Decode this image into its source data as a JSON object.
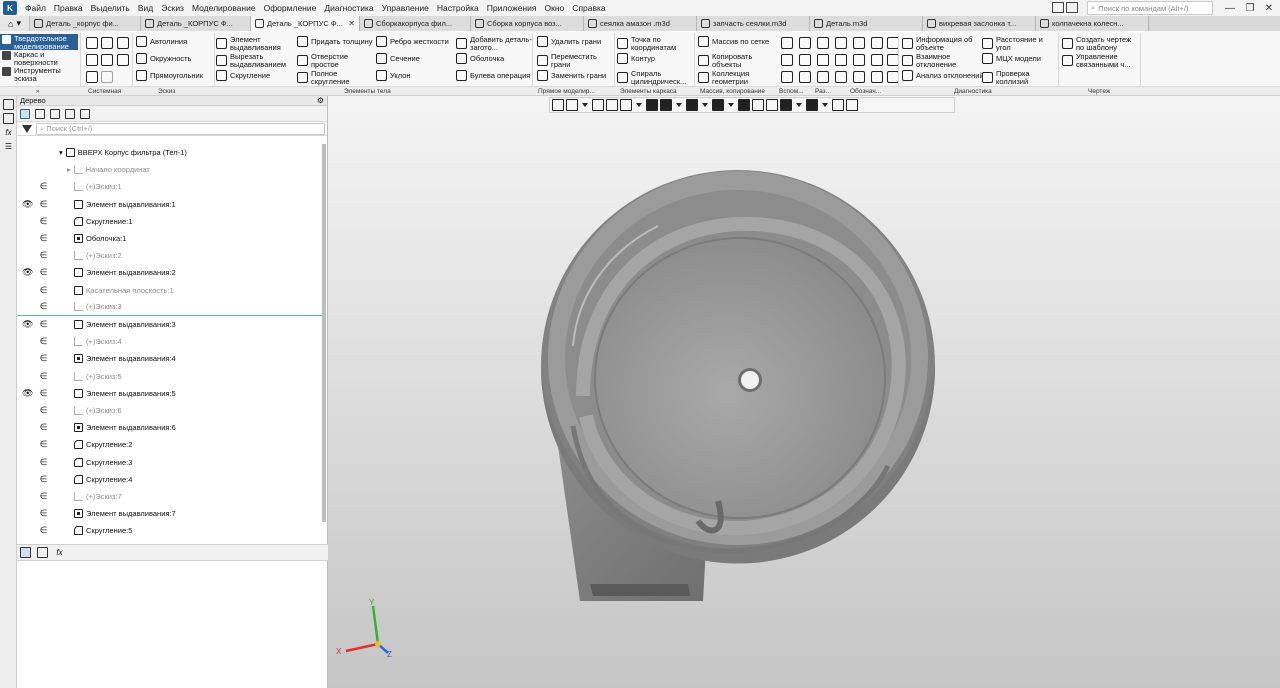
{
  "menu": {
    "items": [
      "Файл",
      "Правка",
      "Выделить",
      "Вид",
      "Эскиз",
      "Моделирование",
      "Оформление",
      "Диагностика",
      "Управление",
      "Настройка",
      "Приложения",
      "Окно",
      "Справка"
    ],
    "search_placeholder": "Поиск по командам (Alt+/)"
  },
  "tabs": [
    {
      "label": "Деталь _корпус фи...",
      "active": false
    },
    {
      "label": "Деталь _КОРПУС Ф...",
      "active": false
    },
    {
      "label": "Деталь _КОРПУС Ф...",
      "active": true
    },
    {
      "label": "Сборкакорпуса фил...",
      "active": false
    },
    {
      "label": "Сборка корпуса воз...",
      "active": false
    },
    {
      "label": "сеялка амазон .m3d",
      "active": false
    },
    {
      "label": "запчасть сеялки.m3d",
      "active": false
    },
    {
      "label": "Деталь.m3d",
      "active": false
    },
    {
      "label": "вихревая заслонка т...",
      "active": false
    },
    {
      "label": "колпачекна колесн...",
      "active": false
    }
  ],
  "mode_panel": {
    "items": [
      {
        "label": "Твердотельное моделирование",
        "active": true
      },
      {
        "label": "Каркас и поверхности",
        "active": false
      },
      {
        "label": "Инструменты эскиза",
        "active": false
      }
    ]
  },
  "ribbon": {
    "sketch": [
      "Автолиния",
      "Окружность",
      "Прямоугольник"
    ],
    "body1": [
      "Элемент выдавливания",
      "Вырезать выдавливанием",
      "Скругление"
    ],
    "body2": [
      "Придать толщину",
      "Отверстие простое",
      "Полное скругление"
    ],
    "body3": [
      "Ребро жесткости",
      "Сечение",
      "Уклон"
    ],
    "body4": [
      "Добавить деталь-загото...",
      "Оболочка",
      "Булева операция"
    ],
    "direct": [
      "Удалить грани",
      "Переместить грани",
      "Заменить грани"
    ],
    "frame": [
      "Точка по координатам",
      "Контур",
      "Спираль цилиндрическ..."
    ],
    "array": [
      "Массив по сетке",
      "Копировать объекты",
      "Коллекция геометрии"
    ],
    "diag1": [
      "Информация об объекте",
      "Взаимное отклонение",
      "Анализ отклонений"
    ],
    "diag2": [
      "Расстояние и угол",
      "МЦХ модели",
      "Проверка коллизий"
    ],
    "drawing": [
      "Создать чертеж по шаблону",
      "Управление связанными ч..."
    ],
    "group_labels": {
      "system": "Системная",
      "sketch": "Эскиз",
      "body": "Элементы тела",
      "direct": "Прямое моделир...",
      "frame": "Элементы каркаса",
      "array": "Массив, копирование",
      "aux": "Вспом...",
      "sizes": "Раз...",
      "notation": "Обознач...",
      "diag": "Диагностика",
      "drawing": "Чертеж"
    }
  },
  "tree": {
    "header": "Дерево",
    "search_placeholder": "Поиск (Ctrl+/)",
    "rows": [
      {
        "text": "ВВЕРХ Корпус фильтра (Тел-1)",
        "icon": "part",
        "eye": false,
        "eps": false,
        "dim": false
      },
      {
        "text": "Начало координат",
        "icon": "origin",
        "eye": false,
        "eps": false,
        "dim": true
      },
      {
        "text": "(+)Эскиз:1",
        "icon": "sketch",
        "eye": false,
        "eps": true,
        "dim": true
      },
      {
        "text": "Элемент выдавливания:1",
        "icon": "extrude",
        "eye": true,
        "eps": true,
        "dim": false
      },
      {
        "text": "Скругление:1",
        "icon": "fillet",
        "eye": false,
        "eps": true,
        "dim": false
      },
      {
        "text": "Оболочка:1",
        "icon": "shell",
        "eye": false,
        "eps": true,
        "dim": false
      },
      {
        "text": "(+)Эскиз:2",
        "icon": "sketch",
        "eye": false,
        "eps": true,
        "dim": true
      },
      {
        "text": "Элемент выдавливания:2",
        "icon": "extrude",
        "eye": true,
        "eps": true,
        "dim": false
      },
      {
        "text": "Касательная плоскость:1",
        "icon": "plane",
        "eye": false,
        "eps": true,
        "dim": true
      },
      {
        "text": "(+)Эскиз:3",
        "icon": "sketch",
        "eye": false,
        "eps": true,
        "dim": true
      },
      {
        "text": "Элемент выдавливания:3",
        "icon": "extrude",
        "eye": true,
        "eps": true,
        "dim": false
      },
      {
        "text": "(+)Эскиз:4",
        "icon": "sketch",
        "eye": false,
        "eps": true,
        "dim": true
      },
      {
        "text": "Элемент выдавливания:4",
        "icon": "cut",
        "eye": false,
        "eps": true,
        "dim": false
      },
      {
        "text": "(+)Эскиз:5",
        "icon": "sketch",
        "eye": false,
        "eps": true,
        "dim": true
      },
      {
        "text": "Элемент выдавливания:5",
        "icon": "extrude",
        "eye": true,
        "eps": true,
        "dim": false
      },
      {
        "text": "(+)Эскиз:6",
        "icon": "sketch",
        "eye": false,
        "eps": true,
        "dim": true
      },
      {
        "text": "Элемент выдавливания:6",
        "icon": "cut",
        "eye": false,
        "eps": true,
        "dim": false
      },
      {
        "text": "Скругление:2",
        "icon": "fillet",
        "eye": false,
        "eps": true,
        "dim": false
      },
      {
        "text": "Скругление:3",
        "icon": "fillet",
        "eye": false,
        "eps": true,
        "dim": false
      },
      {
        "text": "Скругление:4",
        "icon": "fillet",
        "eye": false,
        "eps": true,
        "dim": false
      },
      {
        "text": "(+)Эскиз:7",
        "icon": "sketch",
        "eye": false,
        "eps": true,
        "dim": true
      },
      {
        "text": "Элемент выдавливания:7",
        "icon": "cut",
        "eye": false,
        "eps": true,
        "dim": false
      },
      {
        "text": "Скругление:5",
        "icon": "fillet",
        "eye": false,
        "eps": true,
        "dim": false
      }
    ]
  },
  "axes": {
    "x": "X",
    "y": "Y",
    "z": "Z"
  },
  "colors": {
    "accent": "#2b5f96",
    "model": "#8f8f8f",
    "axis_x": "#e03030",
    "axis_y": "#2eb82e",
    "axis_z": "#2f66d0"
  }
}
